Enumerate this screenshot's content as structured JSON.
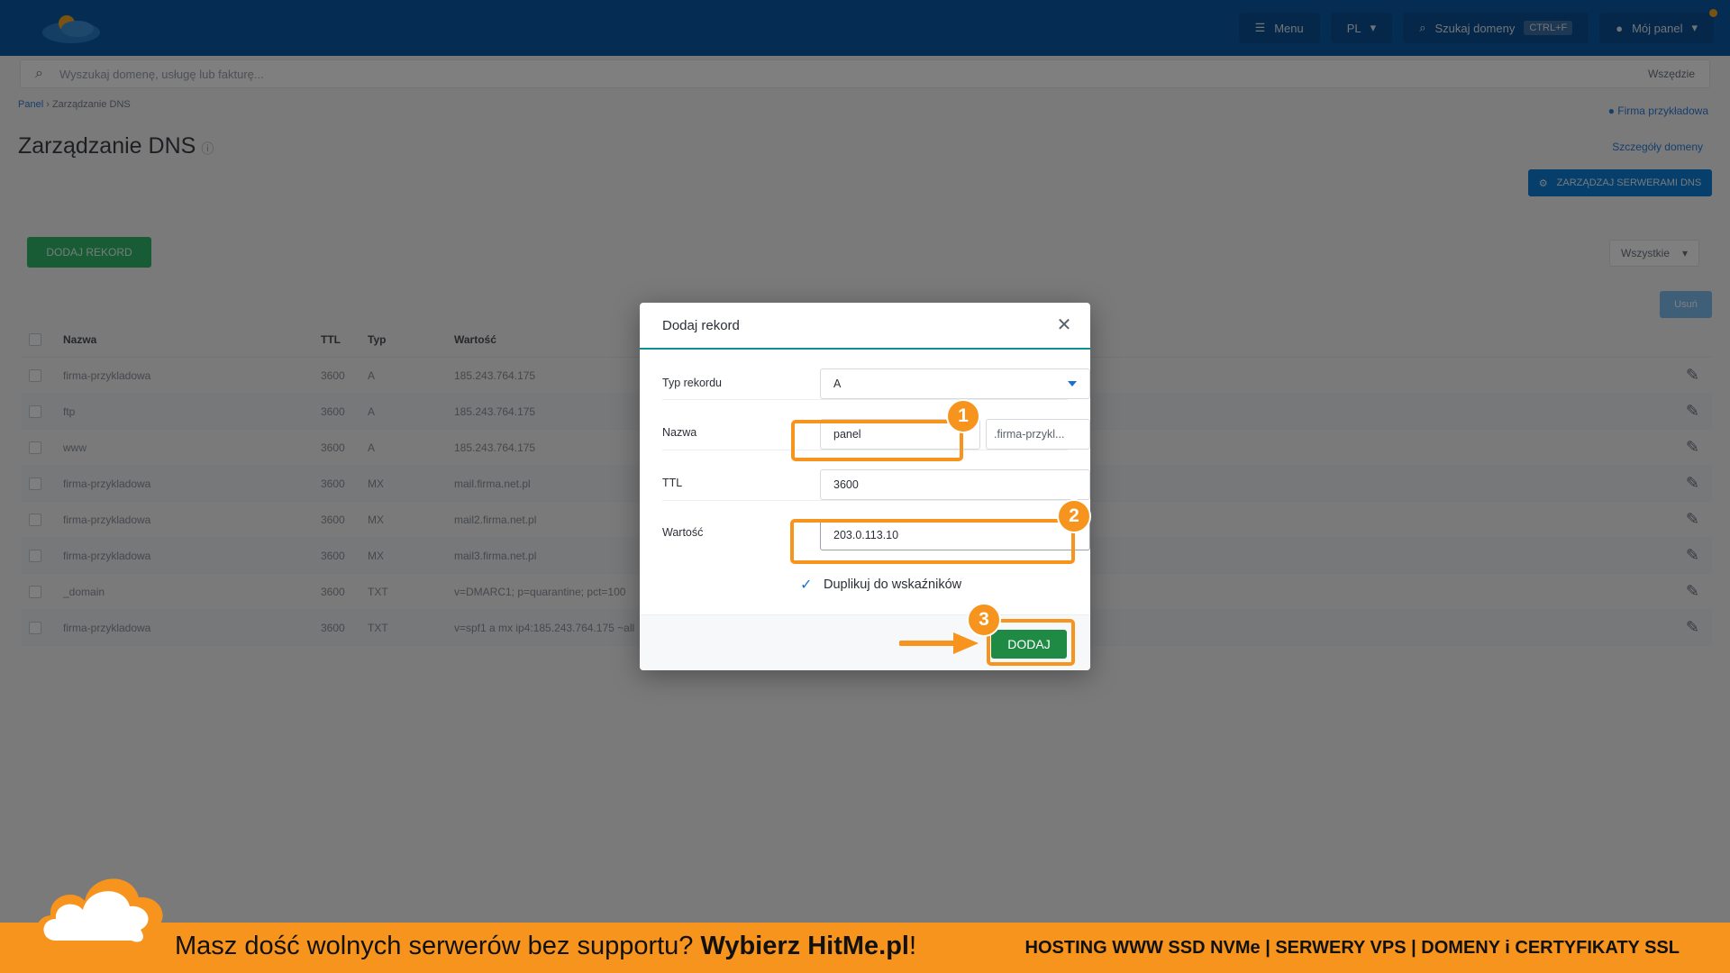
{
  "header": {
    "buttons": [
      {
        "label": "Menu"
      },
      {
        "label": "PL"
      },
      {
        "label": "Szukaj domeny",
        "kbd": "CTRL+F"
      },
      {
        "label": "Mój panel"
      }
    ]
  },
  "search": {
    "placeholder": "Wyszukaj domenę, usługę lub fakturę...",
    "right_label": "Wszędzie"
  },
  "breadcrumb": {
    "root": "Panel",
    "current": "Zarządzanie DNS"
  },
  "page": {
    "company_link": "Firma przykładowa",
    "title": "Zarządzanie DNS",
    "details_link": "Szczegóły domeny",
    "manage_button": "ZARZĄDZAJ SERWERAMI DNS",
    "add_record_button": "DODAJ REKORD",
    "filter_label": "Wszystkie",
    "small_button": "Usuń"
  },
  "table": {
    "headers": {
      "name": "Nazwa",
      "ttl": "TTL",
      "type": "Typ",
      "value": "Wartość"
    },
    "rows": [
      {
        "name": "firma-przykladowa",
        "ttl": "3600",
        "type": "A",
        "value": "185.243.764.175"
      },
      {
        "name": "ftp",
        "ttl": "3600",
        "type": "A",
        "value": "185.243.764.175"
      },
      {
        "name": "www",
        "ttl": "3600",
        "type": "A",
        "value": "185.243.764.175"
      },
      {
        "name": "firma-przykladowa",
        "ttl": "3600",
        "type": "MX",
        "value": "mail.firma.net.pl"
      },
      {
        "name": "firma-przykladowa",
        "ttl": "3600",
        "type": "MX",
        "value": "mail2.firma.net.pl"
      },
      {
        "name": "firma-przykladowa",
        "ttl": "3600",
        "type": "MX",
        "value": "mail3.firma.net.pl"
      },
      {
        "name": "_domain",
        "ttl": "3600",
        "type": "TXT",
        "value": "v=DMARC1; p=quarantine; pct=100"
      },
      {
        "name": "firma-przykladowa",
        "ttl": "3600",
        "type": "TXT",
        "value": "v=spf1 a mx ip4:185.243.764.175 ~all"
      }
    ]
  },
  "modal": {
    "title": "Dodaj rekord",
    "fields": {
      "type_label": "Typ rekordu",
      "type_value": "A",
      "name_label": "Nazwa",
      "name_value": "panel",
      "domain_suffix": ".firma-przykl...",
      "ttl_label": "TTL",
      "ttl_value": "3600",
      "value_label": "Wartość",
      "value_value": "203.0.113.10"
    },
    "duplicate_label": "Duplikuj do wskaźników",
    "duplicate_checked": true,
    "submit_label": "DODAJ"
  },
  "annotations": {
    "step1": "1",
    "step2": "2",
    "step3": "3",
    "color": "#f7941d"
  },
  "banner": {
    "text_normal": "Masz dość wolnych serwerów bez supportu? ",
    "text_bold": "Wybierz HitMe.pl",
    "text_end": "!",
    "right_text": "HOSTING WWW SSD NVMe | SERWERY VPS | DOMENY i CERTYFIKATY SSL",
    "color": "#f7941d"
  }
}
